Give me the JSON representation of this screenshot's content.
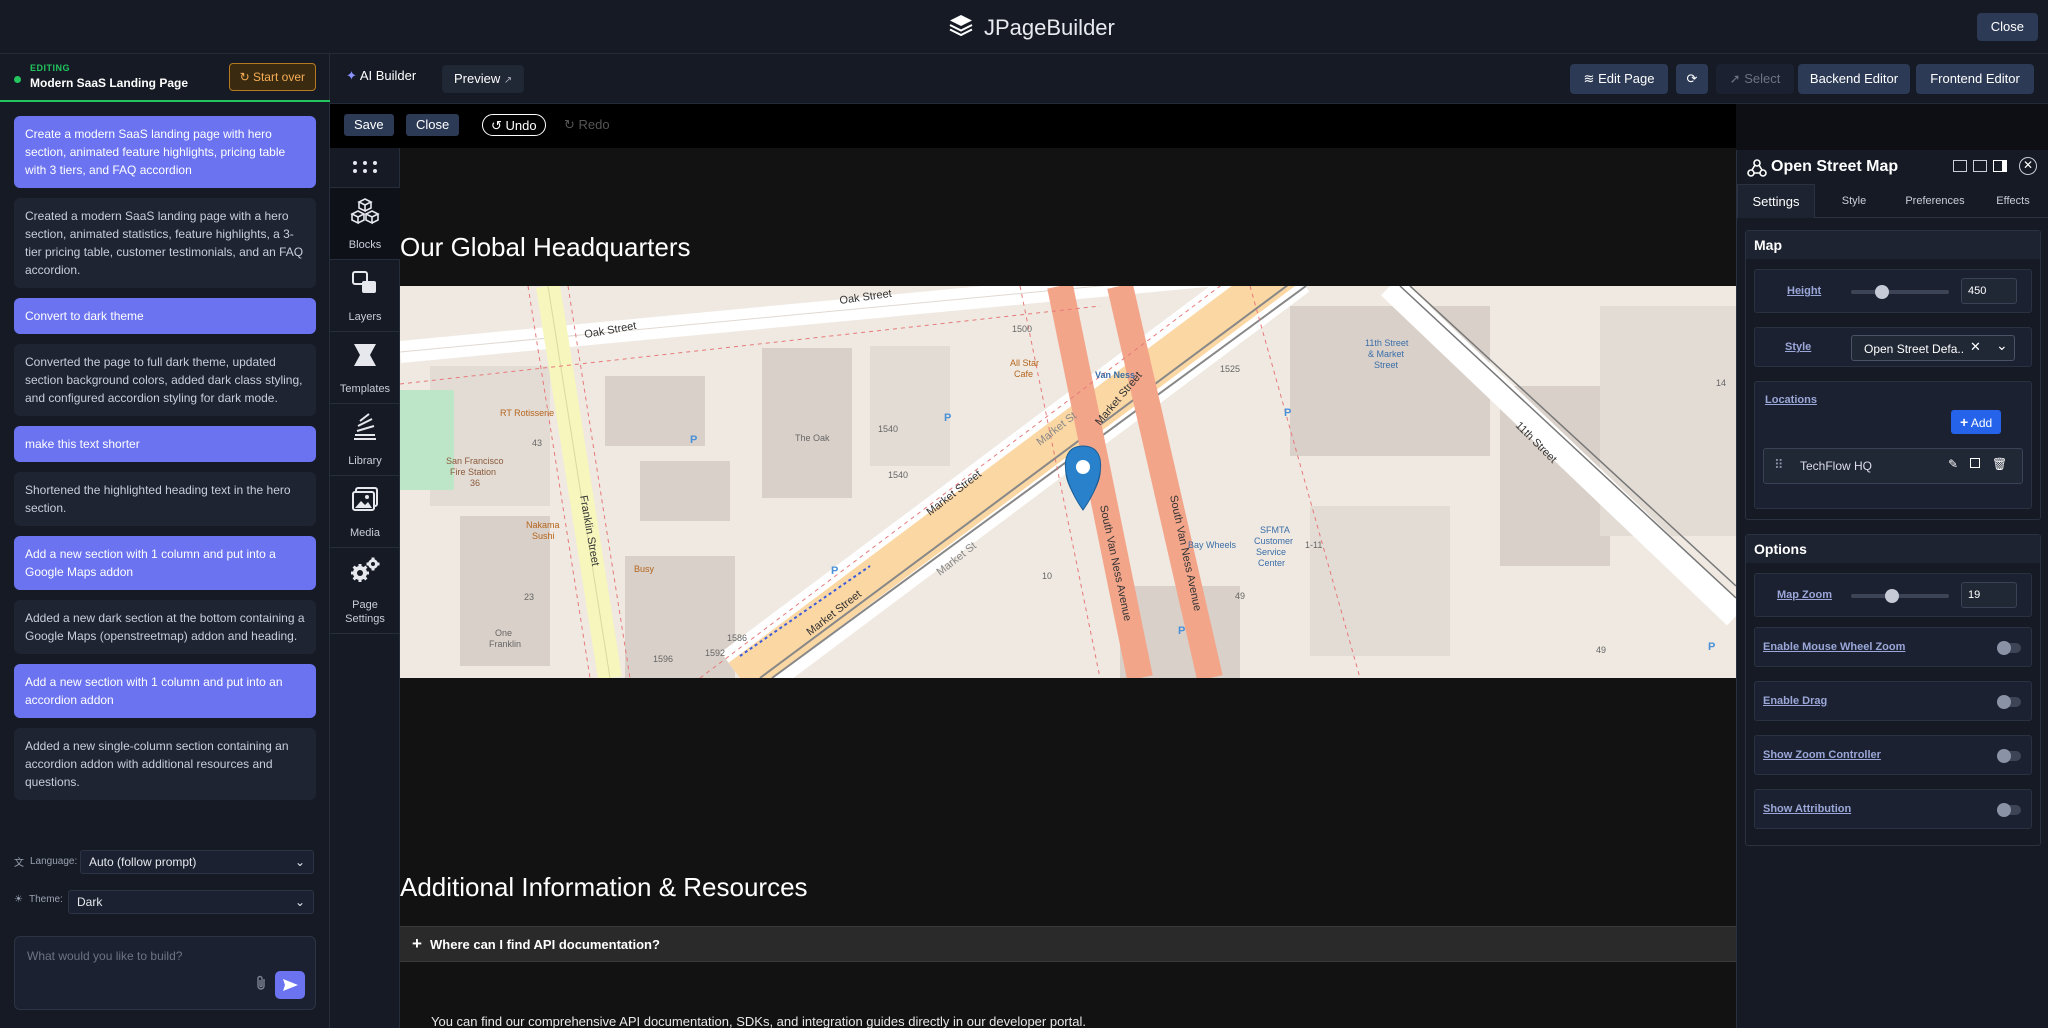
{
  "app": {
    "name": "JPageBuilder",
    "close_label": "Close"
  },
  "chat": {
    "editing_label": "EDITING",
    "page_title": "Modern SaaS Landing Page",
    "start_over_label": "Start over",
    "messages": [
      {
        "role": "user",
        "text": "Create a modern SaaS landing page with hero section, animated feature highlights, pricing table with 3 tiers, and FAQ accordion"
      },
      {
        "role": "ai",
        "text": "Created a modern SaaS landing page with a hero section, animated statistics, feature highlights, a 3-tier pricing table, customer testimonials, and an FAQ accordion."
      },
      {
        "role": "user",
        "text": "Convert to dark theme"
      },
      {
        "role": "ai",
        "text": "Converted the page to full dark theme, updated section background colors, added dark class styling, and configured accordion styling for dark mode."
      },
      {
        "role": "user",
        "text": "make this text shorter"
      },
      {
        "role": "ai",
        "text": "Shortened the highlighted heading text in the hero section."
      },
      {
        "role": "user",
        "text": "Add a new section with 1 column and put into a Google Maps addon"
      },
      {
        "role": "ai",
        "text": "Added a new dark section at the bottom containing a Google Maps (openstreetmap) addon and heading."
      },
      {
        "role": "user",
        "text": "Add a new section with 1 column and put into an accordion addon"
      },
      {
        "role": "ai",
        "text": "Added a new single-column section containing an accordion addon with additional resources and questions."
      }
    ],
    "language_label": "Language:",
    "language_value": "Auto (follow prompt)",
    "theme_label": "Theme:",
    "theme_value": "Dark",
    "prompt_placeholder": "What would you like to build?"
  },
  "toolbar": {
    "ai_builder_label": "AI Builder",
    "preview_label": "Preview",
    "edit_page_label": "Edit Page",
    "select_label": "Select",
    "backend_editor_label": "Backend Editor",
    "frontend_editor_label": "Frontend Editor"
  },
  "canvas_toolbar": {
    "save_label": "Save",
    "close_label": "Close",
    "undo_label": "Undo",
    "redo_label": "Redo"
  },
  "sidebar": {
    "items": [
      {
        "label": "Blocks"
      },
      {
        "label": "Layers"
      },
      {
        "label": "Templates"
      },
      {
        "label": "Library"
      },
      {
        "label": "Media"
      },
      {
        "label_line1": "Page",
        "label_line2": "Settings"
      }
    ]
  },
  "page": {
    "map_heading": "Our Global Headquarters",
    "section_heading": "Additional Information & Resources",
    "accordion_question": "Where can I find API documentation?",
    "accordion_answer": "You can find our comprehensive API documentation, SDKs, and integration guides directly in our developer portal.",
    "map_labels": {
      "oak_street_1": "Oak Street",
      "oak_street_2": "Oak Street",
      "franklin_street": "Franklin Street",
      "market_street_1": "Market Street",
      "market_street_2": "Market Street",
      "market_street_3": "Market Street",
      "market_street_4": "Market St",
      "market_street_5": "Market St",
      "south_van_ness_1": "South Van Ness Avenue",
      "south_van_ness_2": "South Van Ness Avenue",
      "eleventh_street": "11th Street",
      "the_oak": "The Oak",
      "sf_fire_station_1": "San Francisco",
      "sf_fire_station_2": "Fire Station",
      "sf_fire_station_3": "36",
      "rotisserie": "RT Rotisserie",
      "nakama_sushi_1": "Nakama",
      "nakama_sushi_2": "Sushi",
      "one_franklin_1": "One",
      "one_franklin_2": "Franklin",
      "sfmta_1": "SFMTA",
      "sfmta_2": "Customer",
      "sfmta_3": "Service",
      "sfmta_4": "Center",
      "bay_wheels": "Bay Wheels",
      "van_ness_station": "Van Ness",
      "all_star_cafe_1": "All Star",
      "all_star_cafe_2": "Cafe",
      "busy": "Busy",
      "eleventh_market_1": "11th Street",
      "eleventh_market_2": "& Market",
      "eleventh_market_3": "Street",
      "n_1540_a": "1540",
      "n_1540_b": "1540",
      "n_1525": "1525",
      "n_1500": "1500",
      "n_1586": "1586",
      "n_1592": "1592",
      "n_1596": "1596",
      "n_43": "43",
      "n_23": "23",
      "n_10": "10",
      "n_49_a": "49",
      "n_49_b": "49",
      "n_1_11": "1-11",
      "n_14": "14"
    }
  },
  "right_panel": {
    "title": "Open Street Map",
    "tabs": [
      "Settings",
      "Style",
      "Preferences",
      "Effects"
    ],
    "map_group_title": "Map",
    "height_label": "Height",
    "height_value": "450",
    "height_fraction": 0.28,
    "style_label": "Style",
    "style_value": "Open Street Defa..",
    "locations_label": "Locations",
    "add_label": "Add",
    "location_name": "TechFlow HQ",
    "options_group_title": "Options",
    "zoom_label": "Map Zoom",
    "zoom_value": "19",
    "zoom_fraction": 0.4,
    "toggles": [
      {
        "label": "Enable Mouse Wheel Zoom",
        "on": false
      },
      {
        "label": "Enable Drag",
        "on": false
      },
      {
        "label": "Show Zoom Controller",
        "on": false
      },
      {
        "label": "Show Attribution",
        "on": false
      }
    ],
    "colors": {
      "accent": "#2563eb",
      "user_bubble": "#6b73f0",
      "editing": "#22c55e"
    }
  }
}
